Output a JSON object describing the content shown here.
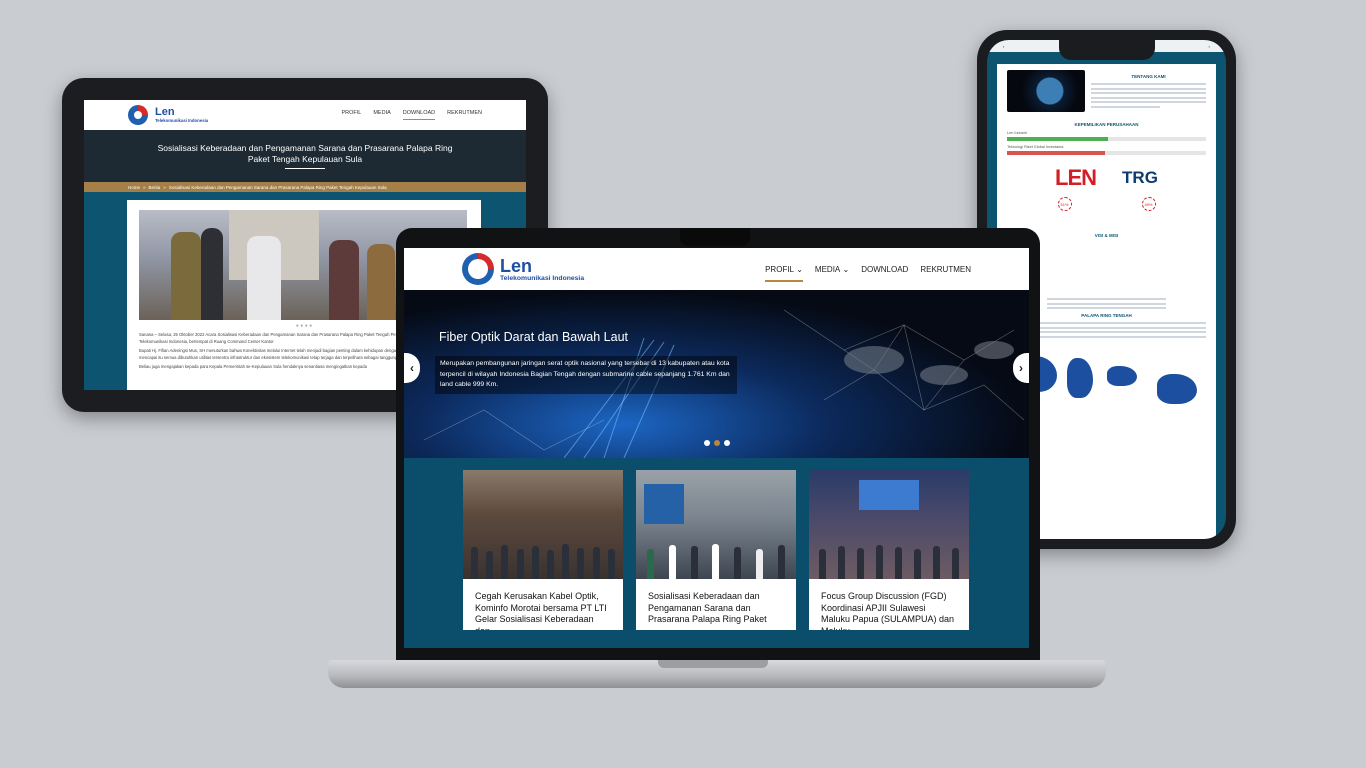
{
  "brand": {
    "name": "Len",
    "sub": "Telekomunikasi Indonesia"
  },
  "nav": [
    "PROFIL",
    "MEDIA",
    "DOWNLOAD",
    "REKRUTMEN"
  ],
  "tablet": {
    "hero_title": "Sosialisasi Keberadaan dan Pengamanan Sarana dan Prasarana Palapa Ring Paket Tengah Kepulauan Sula",
    "breadcrumb": [
      "Home",
      "Berita",
      "Sosialisasi Keberadaan dan Pengamanan Sarana dan Prasarana Palapa Ring Paket Tengah Kepulauan Sula"
    ],
    "paragraphs": [
      "Sanana – Selasa, 25 Oktober 2022 Acara Sosialisasi Keberadaan dan Pengamanan Sarana dan Prasarana Palapa Ring Paket Tengah Pemerintah Kabupaten Sula dan PT Len Telekomunikasi Indonesia, bertempat di Ruang Command Center Kantor",
      "Bupati Hj. Fifian Adeningsi Mus, SH menuturkan bahwa Konektivitas melalui Internet telah menjadi bagian penting dalam kehidupan dengan berbagai inovasi. Namun, untuk mencapai itu semua dibutuhkan utilitas tersentra infrastruktur dan ekosistem telekomunikasi tetap terjaga dan terpelihara sebagai tanggung jawab bersama.",
      "Beliau juga mengajakan kepada para Kepala Pemerintah se-Kepulauan Sula hendaknya senantiasa mengingatkan kepada"
    ]
  },
  "phone": {
    "section_about": "TENTANG KAMI",
    "section_ownership": "KEPEMILIKAN PERUSAHAAN",
    "owner_1": "Len Industri",
    "owner_2": "Teknologi Riset Global Investama",
    "logo_len": "LEN",
    "logo_trg": "TRG",
    "pct_1": "51%",
    "pct_2": "49%",
    "section_vision": "VISI & MISI",
    "section_palapa": "PALAPA RING TENGAH"
  },
  "laptop": {
    "hero_title": "Fiber Optik Darat dan Bawah Laut",
    "hero_desc": "Merupakan pembangunan jaringan serat optik nasional yang tersebar di 13 kabupaten atau kota terpencil di wilayah Indonesia Bagian Tengah dengan submarine cable sepanjang 1.761 Km dan land cable 999 Km.",
    "news": [
      {
        "title": "Cegah Kerusakan Kabel Optik, Kominfo Morotai bersama PT LTI Gelar Sosialisasi Keberadaan dan"
      },
      {
        "title": "Sosialisasi Keberadaan dan Pengamanan Sarana dan Prasarana Palapa Ring Paket"
      },
      {
        "title": "Focus Group Discussion (FGD) Koordinasi APJII Sulawesi Maluku Papua (SULAMPUA) dan Maluku"
      }
    ]
  },
  "colors": {
    "brand_blue": "#1f4fa3",
    "brand_red": "#d62b2b",
    "accent_gold": "#b7873b",
    "teal": "#0b4e6b"
  }
}
